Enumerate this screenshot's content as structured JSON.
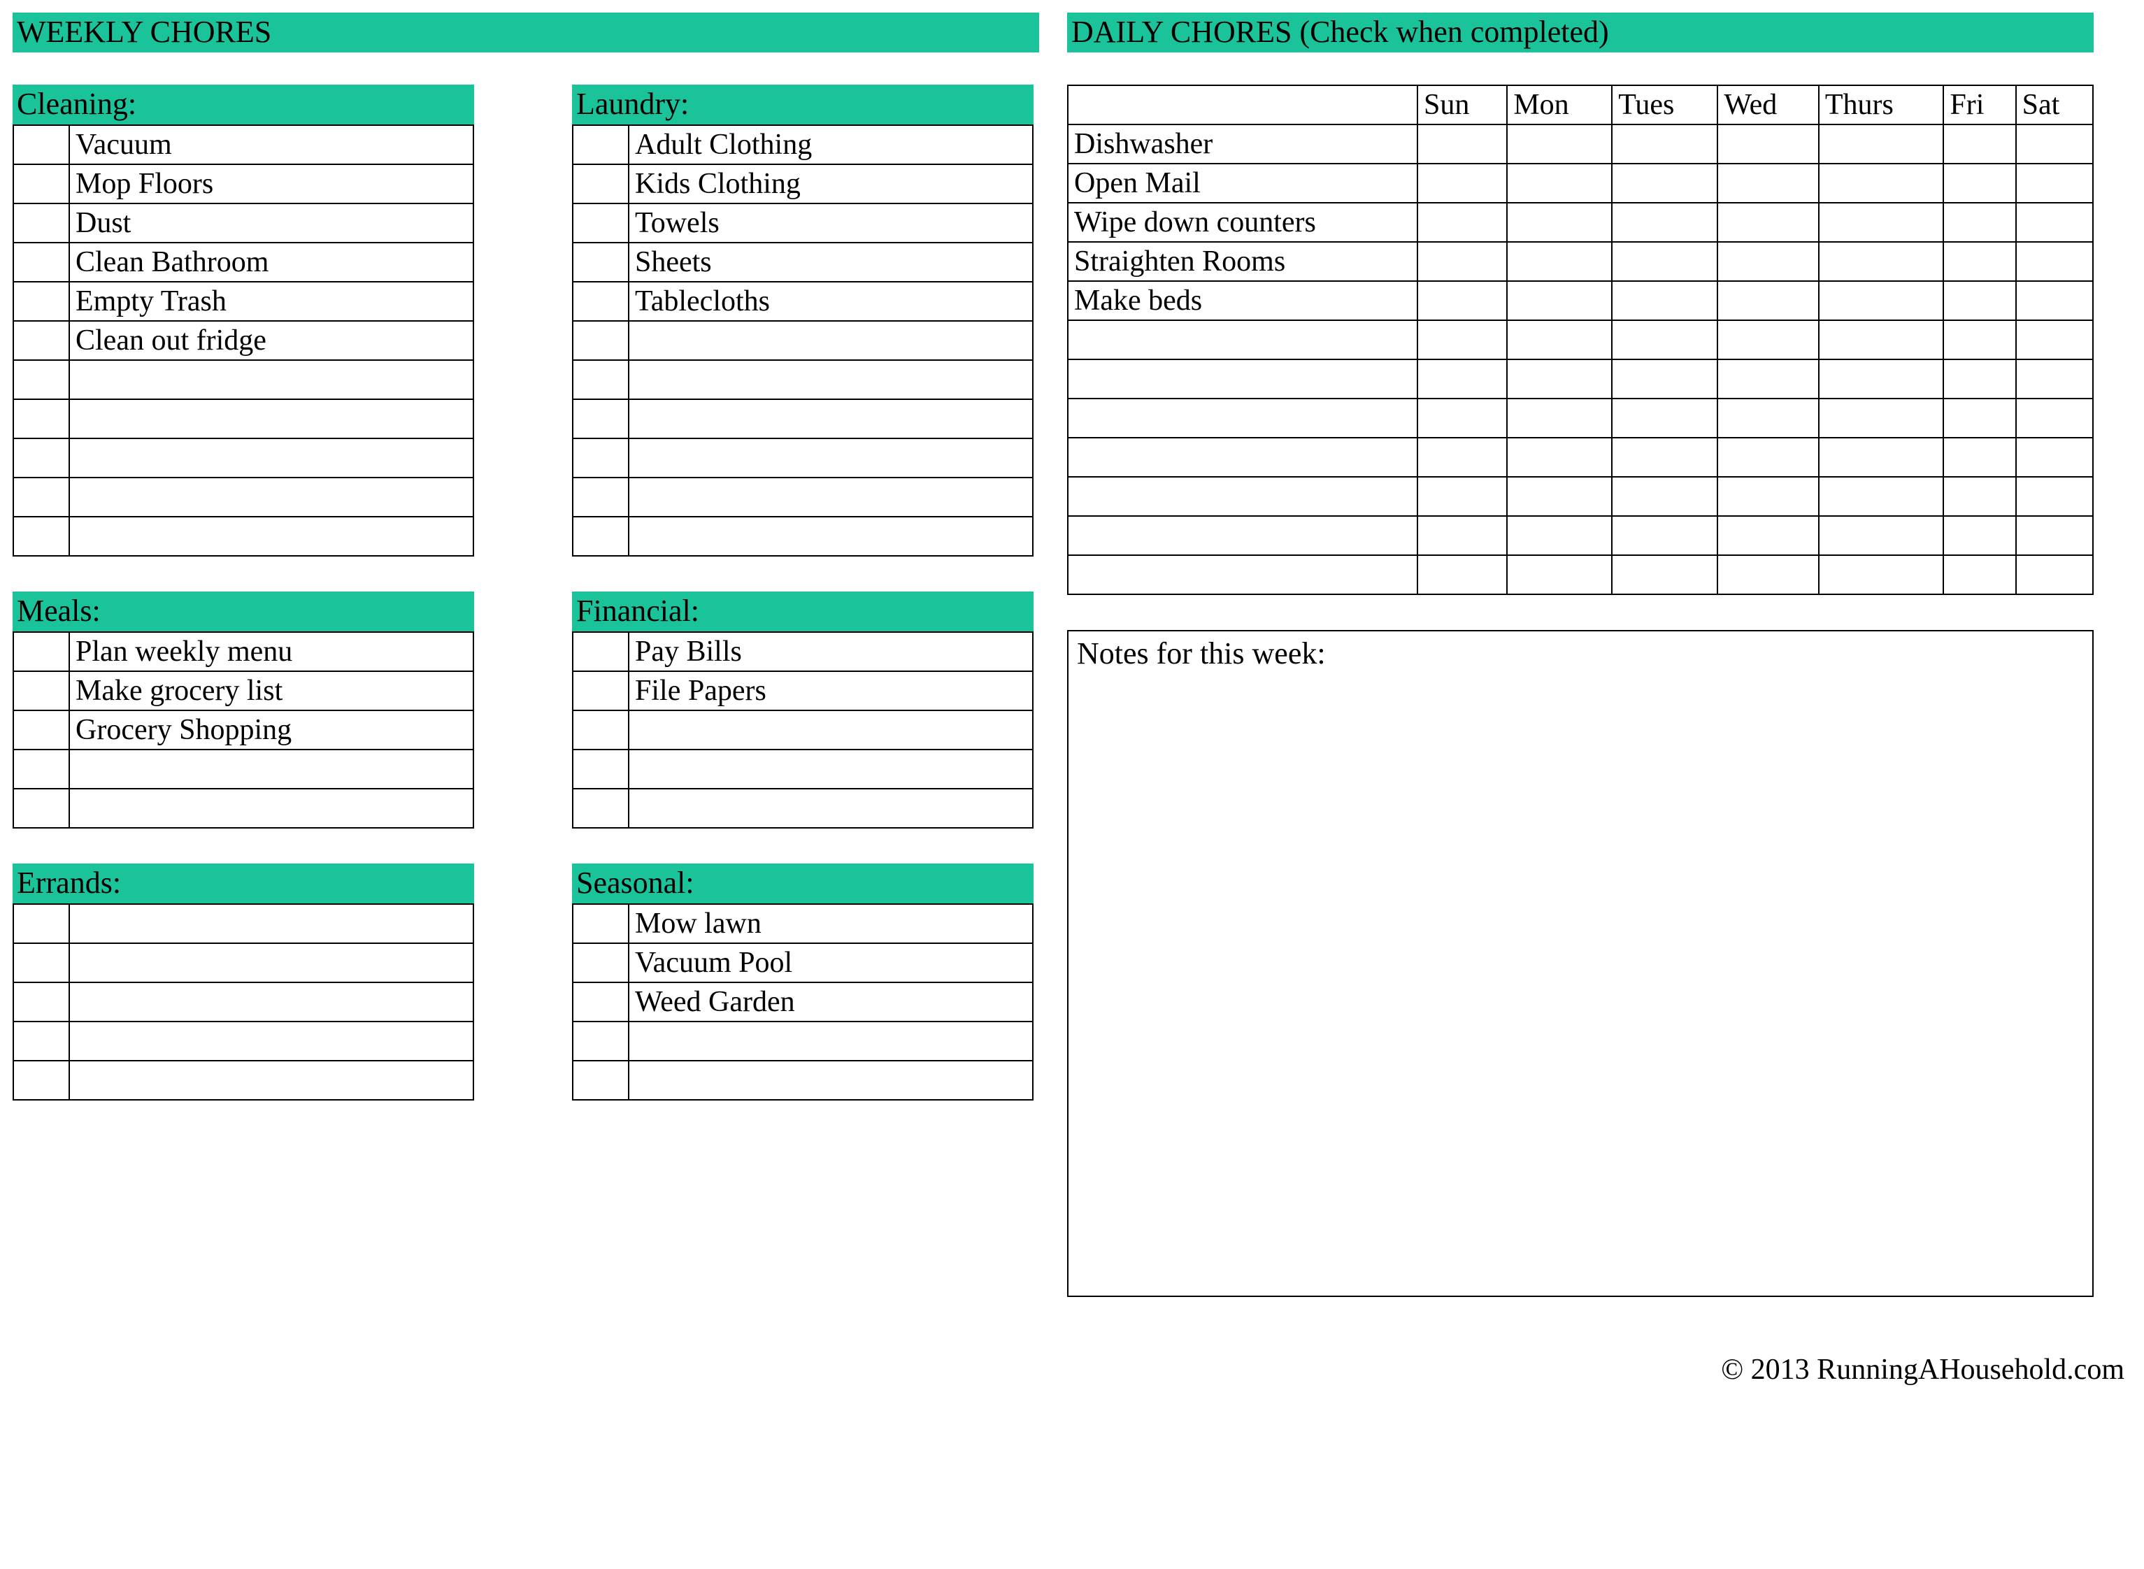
{
  "weekly_banner": "WEEKLY CHORES",
  "daily_banner": "DAILY CHORES (Check when completed)",
  "notes_label": "Notes for this week:",
  "footer": "© 2013 RunningAHousehold.com",
  "days": [
    "Sun",
    "Mon",
    "Tues",
    "Wed",
    "Thurs",
    "Fri",
    "Sat"
  ],
  "weekly": {
    "cleaning": {
      "title": "Cleaning:",
      "rows": 11,
      "items": [
        "Vacuum",
        "Mop Floors",
        "Dust",
        "Clean Bathroom",
        "Empty Trash",
        "Clean out fridge"
      ]
    },
    "laundry": {
      "title": "Laundry:",
      "rows": 11,
      "items": [
        "Adult Clothing",
        "Kids Clothing",
        "Towels",
        "Sheets",
        "Tablecloths"
      ]
    },
    "meals": {
      "title": "Meals:",
      "rows": 5,
      "items": [
        "Plan weekly menu",
        "Make grocery list",
        "Grocery Shopping"
      ]
    },
    "financial": {
      "title": "Financial:",
      "rows": 5,
      "items": [
        "Pay Bills",
        "File Papers"
      ]
    },
    "errands": {
      "title": "Errands:",
      "rows": 5,
      "items": []
    },
    "seasonal": {
      "title": "Seasonal:",
      "rows": 5,
      "items": [
        "Mow lawn",
        "Vacuum Pool",
        "Weed Garden"
      ]
    }
  },
  "daily": {
    "rows": 12,
    "items": [
      "Dishwasher",
      "Open Mail",
      "Wipe down counters",
      "Straighten Rooms",
      "Make beds"
    ]
  }
}
